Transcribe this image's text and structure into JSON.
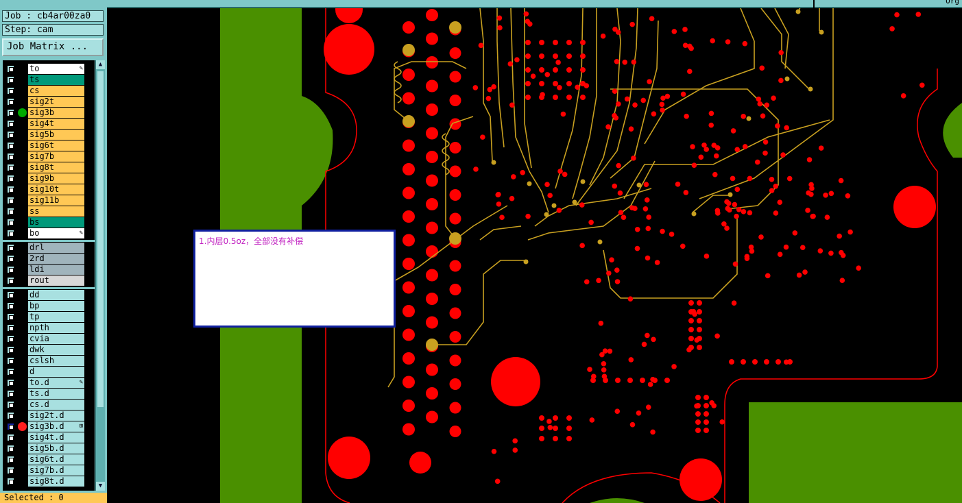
{
  "job": {
    "job_line": "Job : cb4ar00za0",
    "step_line": "Step: cam",
    "job_matrix_label": "Job Matrix ..."
  },
  "colors": {
    "signal": "#ffc855",
    "outer": "#ffffff",
    "mask": "#00997a",
    "silk": "#ffffff",
    "drill": "#a0b4bc",
    "rout": "#d8d8d8",
    "doc": "#a8e0e0",
    "pad": "#ff0000",
    "trace": "#c8a020",
    "board_green": "#4a9000"
  },
  "layer_groups": [
    {
      "layers": [
        {
          "name": "to",
          "color": "#ffffff",
          "marker": "✎"
        },
        {
          "name": "ts",
          "color": "#00997a"
        },
        {
          "name": "cs",
          "color": "#ffc855"
        },
        {
          "name": "sig2t",
          "color": "#ffc855"
        },
        {
          "name": "sig3b",
          "color": "#ffc855",
          "dot": "#00aa00"
        },
        {
          "name": "sig4t",
          "color": "#ffc855"
        },
        {
          "name": "sig5b",
          "color": "#ffc855"
        },
        {
          "name": "sig6t",
          "color": "#ffc855"
        },
        {
          "name": "sig7b",
          "color": "#ffc855"
        },
        {
          "name": "sig8t",
          "color": "#ffc855"
        },
        {
          "name": "sig9b",
          "color": "#ffc855"
        },
        {
          "name": "sig10t",
          "color": "#ffc855"
        },
        {
          "name": "sig11b",
          "color": "#ffc855"
        },
        {
          "name": "ss",
          "color": "#ffc855"
        },
        {
          "name": "bs",
          "color": "#00997a"
        },
        {
          "name": "bo",
          "color": "#ffffff",
          "marker": "✎"
        }
      ]
    },
    {
      "layers": [
        {
          "name": "drl",
          "color": "#a0b4bc"
        },
        {
          "name": "2rd",
          "color": "#a0b4bc"
        },
        {
          "name": "ldi",
          "color": "#a0b4bc"
        },
        {
          "name": "rout",
          "color": "#d8d8d8"
        }
      ]
    },
    {
      "layers": [
        {
          "name": "dd",
          "color": "#a8e0e0"
        },
        {
          "name": "bp",
          "color": "#a8e0e0"
        },
        {
          "name": "tp",
          "color": "#a8e0e0"
        },
        {
          "name": "npth",
          "color": "#a8e0e0"
        },
        {
          "name": "cvia",
          "color": "#a8e0e0"
        },
        {
          "name": "dwk",
          "color": "#a8e0e0"
        },
        {
          "name": "cslsh",
          "color": "#a8e0e0"
        },
        {
          "name": "d",
          "color": "#a8e0e0"
        },
        {
          "name": "to.d",
          "color": "#a8e0e0",
          "marker": "✎"
        },
        {
          "name": "ts.d",
          "color": "#a8e0e0"
        },
        {
          "name": "cs.d",
          "color": "#a8e0e0"
        },
        {
          "name": "sig2t.d",
          "color": "#a8e0e0"
        },
        {
          "name": "sig3b.d",
          "color": "#a8e0e0",
          "dot": "#ff2020",
          "active": true,
          "marker": "⊞"
        },
        {
          "name": "sig4t.d",
          "color": "#a8e0e0"
        },
        {
          "name": "sig5b.d",
          "color": "#a8e0e0"
        },
        {
          "name": "sig6t.d",
          "color": "#a8e0e0"
        },
        {
          "name": "sig7b.d",
          "color": "#a8e0e0"
        },
        {
          "name": "sig8t.d",
          "color": "#a8e0e0"
        }
      ]
    }
  ],
  "status": {
    "selected": "Selected : 0"
  },
  "top_right_text": "Org",
  "note": {
    "text": "1.内层0.5oz，全部没有补偿"
  },
  "icons": {
    "scroll_up": "up-arrow-icon",
    "scroll_down": "down-arrow-icon",
    "edit_marker": "pencil-icon"
  }
}
